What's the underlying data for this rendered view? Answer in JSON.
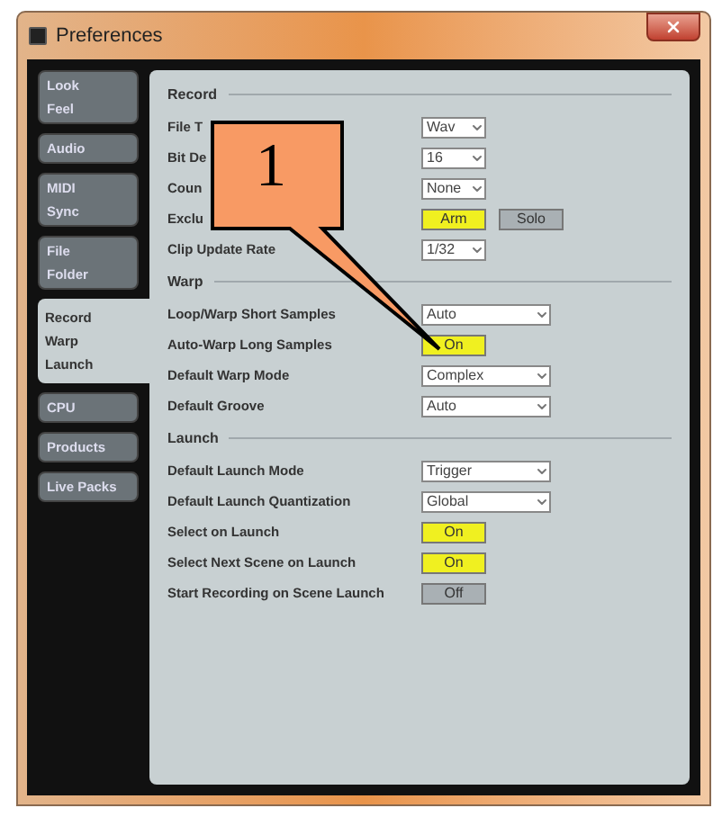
{
  "window": {
    "title": "Preferences"
  },
  "sidebar": {
    "items": [
      {
        "label": "Look\nFeel",
        "selected": false
      },
      {
        "label": "Audio",
        "selected": false
      },
      {
        "label": "MIDI\nSync",
        "selected": false
      },
      {
        "label": "File\nFolder",
        "selected": false
      },
      {
        "label": "Record\nWarp\nLaunch",
        "selected": true
      },
      {
        "label": "CPU",
        "selected": false
      },
      {
        "label": "Products",
        "selected": false
      },
      {
        "label": "Live Packs",
        "selected": false
      }
    ]
  },
  "sections": [
    {
      "title": "Record",
      "rows": [
        {
          "label": "File T",
          "controls": [
            {
              "kind": "short-select",
              "value": "Wav"
            }
          ]
        },
        {
          "label": "Bit De",
          "controls": [
            {
              "kind": "short-select",
              "value": "16"
            }
          ]
        },
        {
          "label": "Coun",
          "controls": [
            {
              "kind": "short-select",
              "value": "None"
            }
          ]
        },
        {
          "label": "Exclu",
          "controls": [
            {
              "kind": "toggle",
              "label": "Arm",
              "on": true
            },
            {
              "kind": "toggle",
              "label": "Solo",
              "on": false
            }
          ]
        },
        {
          "label": "Clip Update Rate",
          "controls": [
            {
              "kind": "short-select",
              "value": "1/32"
            }
          ]
        }
      ]
    },
    {
      "title": "Warp",
      "rows": [
        {
          "label": "Loop/Warp Short Samples",
          "controls": [
            {
              "kind": "select",
              "value": "Auto"
            }
          ]
        },
        {
          "label": "Auto-Warp Long Samples",
          "controls": [
            {
              "kind": "toggle",
              "label": "On",
              "on": true
            }
          ]
        },
        {
          "label": "Default Warp Mode",
          "controls": [
            {
              "kind": "select",
              "value": "Complex"
            }
          ]
        },
        {
          "label": "Default Groove",
          "controls": [
            {
              "kind": "select",
              "value": "Auto"
            }
          ]
        }
      ]
    },
    {
      "title": "Launch",
      "rows": [
        {
          "label": "Default Launch Mode",
          "controls": [
            {
              "kind": "select",
              "value": "Trigger"
            }
          ]
        },
        {
          "label": "Default Launch Quantization",
          "controls": [
            {
              "kind": "select",
              "value": "Global"
            }
          ]
        },
        {
          "label": "Select on Launch",
          "controls": [
            {
              "kind": "toggle",
              "label": "On",
              "on": true
            }
          ]
        },
        {
          "label": "Select Next Scene on Launch",
          "controls": [
            {
              "kind": "toggle",
              "label": "On",
              "on": true
            }
          ]
        },
        {
          "label": "Start Recording on Scene Launch",
          "controls": [
            {
              "kind": "toggle",
              "label": "Off",
              "on": false
            }
          ]
        }
      ]
    }
  ],
  "callout": {
    "label": "1"
  }
}
